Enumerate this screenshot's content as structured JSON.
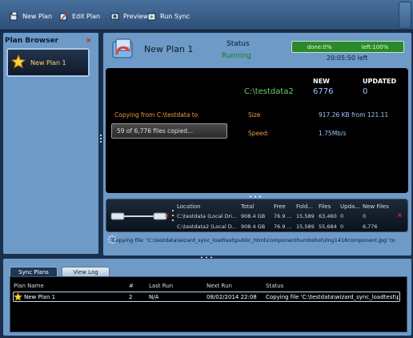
{
  "toolbar": {
    "new_plan": "New Plan",
    "edit_plan": "Edit Plan",
    "preview": "Preview",
    "run_sync": "Run Sync"
  },
  "browser": {
    "title": "Plan Browser",
    "close": "×",
    "plan_name": "New Plan 1"
  },
  "header": {
    "plan_title": "New Plan 1",
    "status_label": "Status",
    "status_value": "Running",
    "done": "done:0%",
    "left": "left:100%",
    "time_left": "20:05:50 left"
  },
  "stats": {
    "new_label": "NEW",
    "updated_label": "UPDATED",
    "path": "C:\\testdata2",
    "new_value": "6776",
    "updated_value": "0",
    "copying_label": "Copying from C:\\testdata to",
    "copy_progress": "59 of 6,776 files copied...",
    "size_label": "Size",
    "size_value": "917.26 KB from 121.11",
    "speed_label": "Speed:",
    "speed_value": "1.75Mb/s"
  },
  "locations": {
    "headers": [
      "Location",
      "Total",
      "Free",
      "Fold...",
      "Files",
      "Upda...",
      "New Files"
    ],
    "rows": [
      [
        "C:\\testdata (Local Dri...",
        "908.4 GB",
        "76.9 ...",
        "15,589",
        "63,460",
        "0",
        "0"
      ],
      [
        "C:\\testdata2 (Local D...",
        "908.4 GB",
        "76.9 ...",
        "15,589",
        "55,684",
        "0",
        "6,776"
      ]
    ]
  },
  "status_line": "Copying file: 'C:\\testdata\\wizard_sync_loadtest\\public_html\\componenthumbshot\\img1416component.jpg' to",
  "bottom": {
    "tab_sync": "Sync Plans",
    "tab_log": "View Log",
    "headers": [
      "Plan Name",
      "#",
      "Last Run",
      "Next Run",
      "Status"
    ],
    "row": [
      "New Plan 1",
      "2",
      "N/A",
      "08/02/2014 22:08",
      "Copying  file  'C:\\testdata\\wizard_sync_loadtest\\pu..."
    ]
  },
  "colors": {
    "panel": "#6d9ac7",
    "accent_orange": "#e8a040",
    "accent_green": "#6fd06f",
    "accent_blue": "#9fc7ff"
  },
  "icons": [
    "new-plan-icon",
    "edit-plan-icon",
    "preview-icon",
    "run-sync-icon",
    "star-icon",
    "sync-logo-icon",
    "drive-icon",
    "close-icon",
    "spinner-icon"
  ]
}
